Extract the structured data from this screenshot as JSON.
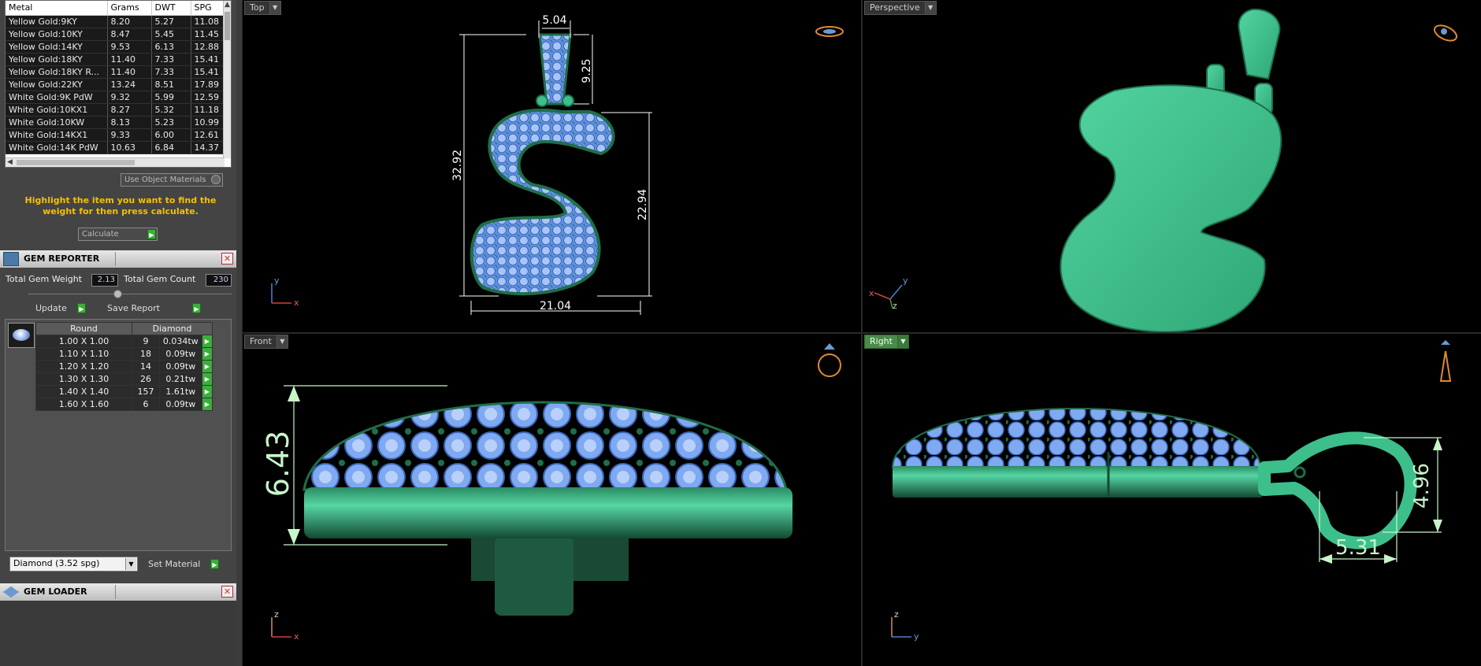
{
  "metal_table": {
    "headers": [
      "Metal",
      "Grams",
      "DWT",
      "SPG"
    ],
    "rows": [
      [
        "Yellow Gold:9KY",
        "8.20",
        "5.27",
        "11.08"
      ],
      [
        "Yellow Gold:10KY",
        "8.47",
        "5.45",
        "11.45"
      ],
      [
        "Yellow Gold:14KY",
        "9.53",
        "6.13",
        "12.88"
      ],
      [
        "Yellow Gold:18KY",
        "11.40",
        "7.33",
        "15.41"
      ],
      [
        "Yellow Gold:18KY R...",
        "11.40",
        "7.33",
        "15.41"
      ],
      [
        "Yellow Gold:22KY",
        "13.24",
        "8.51",
        "17.89"
      ],
      [
        "White Gold:9K PdW",
        "9.32",
        "5.99",
        "12.59"
      ],
      [
        "White Gold:10KX1",
        "8.27",
        "5.32",
        "11.18"
      ],
      [
        "White Gold:10KW",
        "8.13",
        "5.23",
        "10.99"
      ],
      [
        "White Gold:14KX1",
        "9.33",
        "6.00",
        "12.61"
      ],
      [
        "White Gold:14K PdW",
        "10.63",
        "6.84",
        "14.37"
      ]
    ]
  },
  "use_object_materials": "Use Object Materials",
  "hint": "Highlight the item you want to find the weight for then press calculate.",
  "calculate_label": "Calculate",
  "gem_reporter": {
    "title": "GEM REPORTER",
    "total_weight_label": "Total Gem Weight",
    "total_weight_value": "2.13",
    "total_count_label": "Total Gem Count",
    "total_count_value": "230",
    "update_label": "Update",
    "save_report_label": "Save Report",
    "table_headers": [
      "Round",
      "Diamond"
    ],
    "rows": [
      [
        "1.00 X 1.00",
        "9",
        "0.034tw"
      ],
      [
        "1.10 X 1.10",
        "18",
        "0.09tw"
      ],
      [
        "1.20 X 1.20",
        "14",
        "0.09tw"
      ],
      [
        "1.30 X 1.30",
        "26",
        "0.21tw"
      ],
      [
        "1.40 X 1.40",
        "157",
        "1.61tw"
      ],
      [
        "1.60 X 1.60",
        "6",
        "0.09tw"
      ]
    ],
    "material_select": "Diamond    (3.52 spg)",
    "set_material_label": "Set Material"
  },
  "gem_loader": {
    "title": "GEM LOADER"
  },
  "viewports": {
    "top": {
      "label": "Top",
      "dims": {
        "bail_width": "5.04",
        "bail_height": "9.25",
        "total_height": "32.92",
        "body_height": "22.94",
        "width": "21.04"
      },
      "axes": [
        "y",
        "x"
      ]
    },
    "perspective": {
      "label": "Perspective",
      "axes": [
        "y",
        "x",
        "z"
      ]
    },
    "front": {
      "label": "Front",
      "dims": {
        "height": "6.43"
      },
      "axes": [
        "z",
        "x"
      ]
    },
    "right": {
      "label": "Right",
      "dims": {
        "bail_height": "4.96",
        "bail_width": "5.31"
      },
      "axes": [
        "z",
        "y"
      ]
    }
  },
  "colors": {
    "metal": "#3dbf8c",
    "gem": "#7fa9f0",
    "prong": "#1f6e4a",
    "dimension": "#ffffff",
    "front_dim": "#c8f5c8",
    "active_label": "#4a8a4a"
  }
}
